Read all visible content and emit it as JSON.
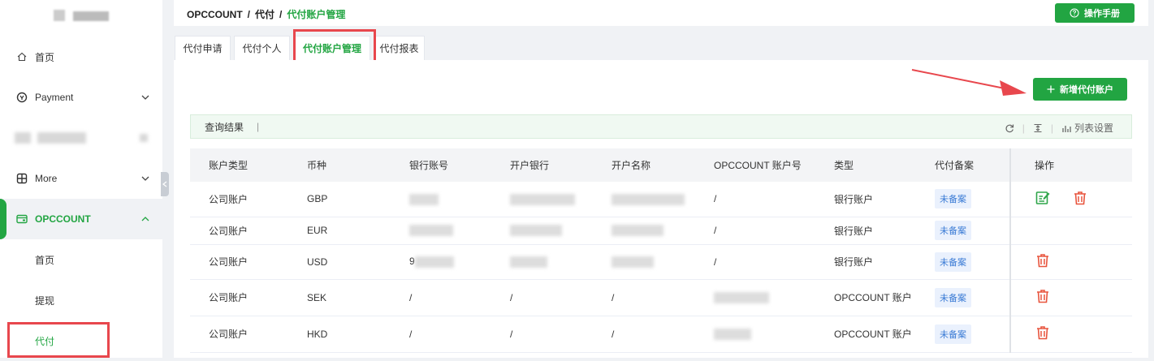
{
  "sidebar": {
    "items": [
      {
        "label": "首页",
        "icon": "home-icon"
      },
      {
        "label": "Payment",
        "icon": "payment-icon"
      },
      {
        "label": "More",
        "icon": "grid-icon"
      },
      {
        "label": "OPCCOUNT",
        "icon": "card-icon"
      }
    ],
    "sub_items": [
      {
        "label": "首页"
      },
      {
        "label": "提现"
      },
      {
        "label": "代付"
      }
    ]
  },
  "header": {
    "crumbs": [
      "OPCCOUNT",
      "代付",
      "代付账户管理"
    ],
    "manual_label": "操作手册"
  },
  "tabs": [
    {
      "label": "代付申请"
    },
    {
      "label": "代付个人"
    },
    {
      "label": "代付账户管理"
    },
    {
      "label": "代付报表"
    }
  ],
  "main": {
    "add_label": "新增代付账户",
    "query_label": "查询结果",
    "list_settings_label": "列表设置"
  },
  "table": {
    "headers": [
      "账户类型",
      "币种",
      "银行账号",
      "开户银行",
      "开户名称",
      "OPCCOUNT 账户号",
      "类型",
      "代付备案",
      "操作"
    ],
    "rows": [
      {
        "type": "公司账户",
        "currency": "GBP",
        "bank_account": "",
        "bank": "",
        "name": "",
        "opc_account": "/",
        "kind": "银行账户",
        "filing": "未备案",
        "actions": [
          "edit",
          "delete"
        ]
      },
      {
        "type": "公司账户",
        "currency": "EUR",
        "bank_account": "",
        "bank": "",
        "name": "",
        "opc_account": "/",
        "kind": "银行账户",
        "filing": "未备案",
        "actions": []
      },
      {
        "type": "公司账户",
        "currency": "USD",
        "bank_account": "9",
        "bank": "",
        "name": "",
        "opc_account": "/",
        "kind": "银行账户",
        "filing": "未备案",
        "actions": [
          "delete"
        ]
      },
      {
        "type": "公司账户",
        "currency": "SEK",
        "bank_account": "/",
        "bank": "/",
        "name": "/",
        "opc_account": "",
        "kind": "OPCCOUNT 账户",
        "filing": "未备案",
        "actions": [
          "delete"
        ]
      },
      {
        "type": "公司账户",
        "currency": "HKD",
        "bank_account": "/",
        "bank": "/",
        "name": "/",
        "opc_account": "",
        "kind": "OPCCOUNT 账户",
        "filing": "未备案",
        "actions": [
          "delete"
        ]
      }
    ]
  },
  "colors": {
    "accent": "#22a542",
    "highlight": "#e8474d",
    "delete": "#e8553e",
    "badge_text": "#3a7bd5"
  }
}
